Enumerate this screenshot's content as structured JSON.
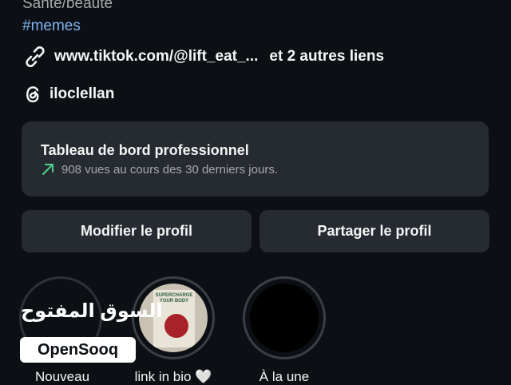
{
  "profile": {
    "category": "Santé/beauté",
    "hashtag": "#memes",
    "link_text": "www.tiktok.com/@lift_eat_...",
    "link_more": "et 2 autres liens",
    "threads_handle": "iloclellan"
  },
  "dashboard": {
    "title": "Tableau de bord professionnel",
    "subtitle": "908 vues au cours des 30 derniers jours."
  },
  "buttons": {
    "edit_profile": "Modifier le profil",
    "share_profile": "Partager le profil"
  },
  "highlights": [
    {
      "label": "Nouveau"
    },
    {
      "label": "link in bio 🤍",
      "cover_text": "SUPERCHARGE YOUR BODY"
    },
    {
      "label": "À la une"
    }
  ],
  "watermark": {
    "arabic": "السوق المفتوح",
    "brand": "OpenSooq"
  },
  "colors": {
    "background": "#0c1014",
    "card": "#262a31",
    "hashtag": "#7db4f0",
    "trend_arrow": "#4fd18b"
  }
}
